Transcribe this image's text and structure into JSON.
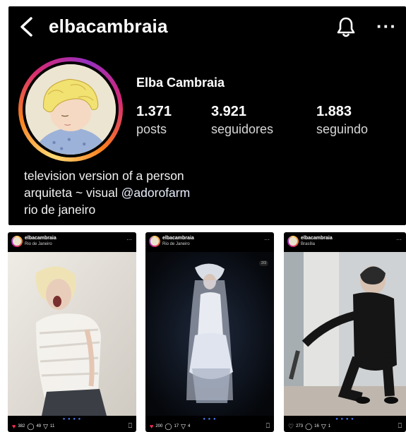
{
  "header": {
    "username": "elbacambraia",
    "back_icon": "chevron-left-icon",
    "notifications_icon": "bell-icon",
    "more_icon": "more-horizontal-icon",
    "more_glyph": "···"
  },
  "profile": {
    "display_name": "Elba Cambraia",
    "stats": [
      {
        "value": "1.371",
        "label": "posts"
      },
      {
        "value": "3.921",
        "label": "seguidores"
      },
      {
        "value": "1.883",
        "label": "seguindo"
      }
    ],
    "bio": {
      "line1": "television version of a person",
      "line2_prefix": "arquiteta ~ visual ",
      "line2_mention": "@adorofarm",
      "line3": "rio de janeiro"
    }
  },
  "posts": [
    {
      "user": "elbacambraia",
      "location": "Rio de Janeiro",
      "likes": "382",
      "comments": "49",
      "shares": "11",
      "liked": true
    },
    {
      "user": "elbacambraia",
      "location": "Rio de Janeiro",
      "likes": "200",
      "comments": "17",
      "shares": "4",
      "liked": true,
      "carousel_counter": "2/3"
    },
    {
      "user": "elbacambraia",
      "location": "Brasília",
      "likes": "273",
      "comments": "16",
      "shares": "1",
      "liked": false
    }
  ],
  "colors": {
    "background": "#000000",
    "like": "#ff2d55",
    "carousel_dot": "#4a7cf6"
  }
}
